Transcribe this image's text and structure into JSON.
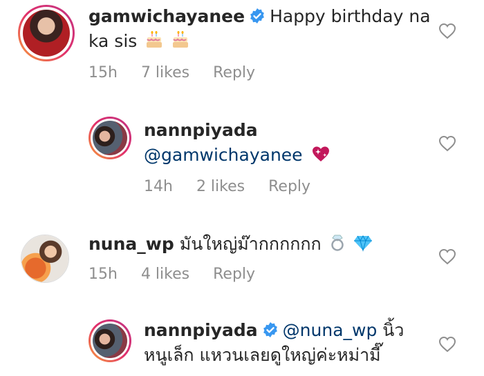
{
  "comments": [
    {
      "username": "gamwichayanee",
      "verified": true,
      "text_line1": "Happy birthday na",
      "text_line2": "ka sis",
      "emoji": [
        "birthday-cake-icon",
        "birthday-cake-icon"
      ],
      "time": "15h",
      "likes": "7 likes",
      "reply_label": "Reply"
    },
    {
      "username": "nannpiyada",
      "verified": false,
      "mention": "@gamwichayanee",
      "emoji": [
        "sparkling-heart-icon"
      ],
      "time": "14h",
      "likes": "2 likes",
      "reply_label": "Reply"
    },
    {
      "username": "nuna_wp",
      "verified": false,
      "text_line1": "มันใหญ่ม๊ากกกกกก",
      "emoji": [
        "ring-icon",
        "gem-icon"
      ],
      "time": "15h",
      "likes": "4 likes",
      "reply_label": "Reply"
    },
    {
      "username": "nannpiyada",
      "verified": true,
      "mention": "@nuna_wp",
      "text_line1": "นิ้ว",
      "text_line2": "หนูเล็ก แหวนเลยดูใหญ่ค่ะหม่ามี๊"
    }
  ],
  "colors": {
    "username": "#262626",
    "meta": "#8e8e8e",
    "mention": "#00376b",
    "verified": "#3897f0"
  }
}
